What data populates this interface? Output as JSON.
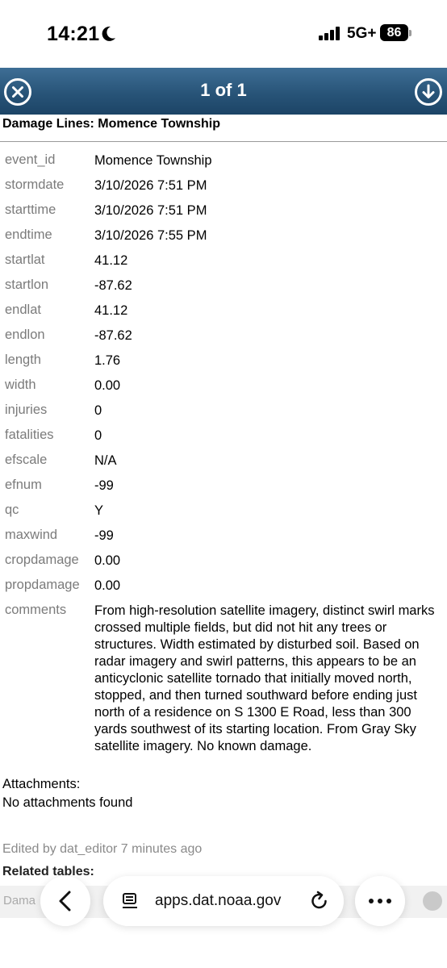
{
  "status_bar": {
    "time": "14:21",
    "network": "5G+",
    "battery": "86",
    "icons": [
      "moon-icon",
      "signal-icon",
      "battery-icon"
    ]
  },
  "popup": {
    "counter": "1 of 1",
    "title": "Damage Lines: Momence Township",
    "header_color": "#285478",
    "icons": [
      "close-icon",
      "download-icon"
    ]
  },
  "attributes": [
    {
      "name": "event_id",
      "value": "Momence Township"
    },
    {
      "name": "stormdate",
      "value": "3/10/2026 7:51 PM"
    },
    {
      "name": "starttime",
      "value": "3/10/2026 7:51 PM"
    },
    {
      "name": "endtime",
      "value": "3/10/2026 7:55 PM"
    },
    {
      "name": "startlat",
      "value": "41.12"
    },
    {
      "name": "startlon",
      "value": "-87.62"
    },
    {
      "name": "endlat",
      "value": "41.12"
    },
    {
      "name": "endlon",
      "value": "-87.62"
    },
    {
      "name": "length",
      "value": "1.76"
    },
    {
      "name": "width",
      "value": "0.00"
    },
    {
      "name": "injuries",
      "value": "0"
    },
    {
      "name": "fatalities",
      "value": "0"
    },
    {
      "name": "efscale",
      "value": "N/A"
    },
    {
      "name": "efnum",
      "value": "-99"
    },
    {
      "name": "qc",
      "value": "Y"
    },
    {
      "name": "maxwind",
      "value": "-99"
    },
    {
      "name": "cropdamage",
      "value": "0.00"
    },
    {
      "name": "propdamage",
      "value": "0.00"
    },
    {
      "name": "comments",
      "value": "From high-resolution satellite imagery, distinct swirl marks crossed multiple fields, but did not hit any trees or structures. Width estimated by disturbed soil. Based on radar imagery and swirl patterns, this appears to be an anticyclonic satellite tornado that initially moved north, stopped, and then turned southward before ending just north of a residence on S 1300 E Road, less than 300 yards southwest of its starting location. From Gray Sky satellite imagery. No known damage."
    }
  ],
  "attachments": {
    "label": "Attachments:",
    "empty_text": "No attachments found"
  },
  "footer": {
    "edited_text": "Edited by dat_editor 7 minutes ago",
    "related_label": "Related tables:",
    "related_item_partial": "Dama"
  },
  "safari": {
    "url": "apps.dat.noaa.gov",
    "icons": [
      "back-icon",
      "reader-icon",
      "reload-icon",
      "more-icon"
    ]
  }
}
